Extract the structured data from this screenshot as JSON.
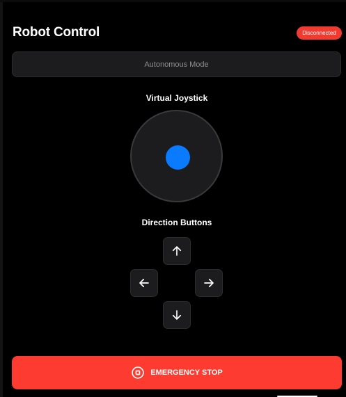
{
  "header": {
    "title": "Robot Control",
    "status": "Disconnected",
    "status_color": "#f13b30"
  },
  "mode_button": {
    "label": "Autonomous Mode"
  },
  "joystick": {
    "label": "Virtual Joystick",
    "knob_color": "#0a7aff",
    "knob_position": {
      "x": 0,
      "y": 0
    }
  },
  "direction_buttons": {
    "label": "Direction Buttons",
    "buttons": [
      {
        "direction": "up",
        "icon": "arrow-up-icon"
      },
      {
        "direction": "left",
        "icon": "arrow-left-icon"
      },
      {
        "direction": "right",
        "icon": "arrow-right-icon"
      },
      {
        "direction": "down",
        "icon": "arrow-down-icon"
      }
    ]
  },
  "emergency_stop": {
    "label": "EMERGENCY STOP",
    "icon": "stop-circle-icon",
    "color": "#fe3b30"
  }
}
